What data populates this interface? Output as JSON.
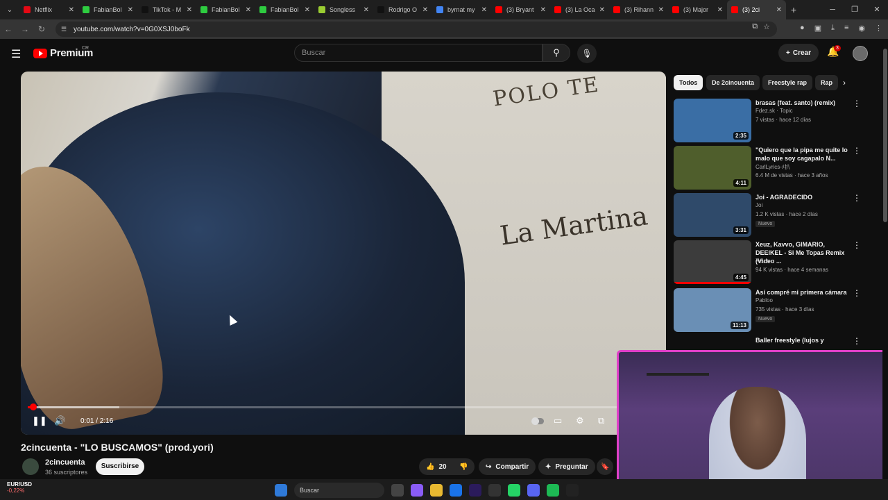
{
  "browser": {
    "tabs": [
      {
        "title": "Netflix",
        "color": "#e50914"
      },
      {
        "title": "FabianBol",
        "color": "#2ecc40"
      },
      {
        "title": "TikTok - M",
        "color": "#111111"
      },
      {
        "title": "FabianBol",
        "color": "#2ecc40"
      },
      {
        "title": "FabianBol",
        "color": "#2ecc40"
      },
      {
        "title": "Songless",
        "color": "#9acd32"
      },
      {
        "title": "Rodrigo O",
        "color": "#111111"
      },
      {
        "title": "byrnat my",
        "color": "#4285f4"
      },
      {
        "title": "(3) Bryant",
        "color": "#ff0000"
      },
      {
        "title": "(3) La Oca",
        "color": "#ff0000"
      },
      {
        "title": "(3) Rihann",
        "color": "#ff0000"
      },
      {
        "title": "(3) Major",
        "color": "#ff0000"
      },
      {
        "title": "(3) 2ci",
        "color": "#ff0000"
      }
    ],
    "url": "youtube.com/watch?v=0G0XSJ0boFk"
  },
  "header": {
    "logo_text": "Premium",
    "region": "CR",
    "search_placeholder": "Buscar",
    "create_label": "Crear",
    "notif_count": "3"
  },
  "player": {
    "time": "0:01 / 2:16",
    "shirt_text1": "POLO TE",
    "shirt_text2": "La Martina",
    "progress_played": 0.008,
    "progress_buffered": 0.145
  },
  "video": {
    "title": "2cincuenta - \"LO BUSCAMOS\" (prod.yori)",
    "channel": "2cincuenta",
    "subscribers": "36 suscriptores",
    "subscribe_label": "Suscribirse",
    "likes": "20",
    "share_label": "Compartir",
    "ask_label": "Preguntar"
  },
  "chips": [
    "Todos",
    "De 2cincuenta",
    "Freestyle rap",
    "Rap"
  ],
  "recommendations": [
    {
      "title": "brasas (feat. santo) (remix)",
      "channel": "Fdez.sk · Topic",
      "meta": "7 vistas · hace 12 días",
      "duration": "2:35",
      "badge": "",
      "thumb": "#3a6ea5"
    },
    {
      "title": "\"Quiero que la pipa me quite lo malo que soy cagapalo N...",
      "channel": "CarlLyrics-ﾒ扒",
      "meta": "6.4 M de vistas · hace 3 años",
      "duration": "4:11",
      "badge": "",
      "thumb": "#4f5e2c"
    },
    {
      "title": "Joi - AGRADECIDO",
      "channel": "Joi",
      "meta": "1.2 K vistas · hace 2 días",
      "duration": "3:31",
      "badge": "Nuevo",
      "thumb": "#2f4a6a"
    },
    {
      "title": "Xeuz, Kavvo, GIMARIO, DEEIKEL - Si Me Topas Remix (Video ...",
      "channel": "Xeuz",
      "meta": "94 K vistas · hace 4 semanas",
      "duration": "4:45",
      "badge": "",
      "thumb": "#3c3c3c"
    },
    {
      "title": "Así compré mi primera cámara",
      "channel": "Pabloo",
      "meta": "735 vistas · hace 3 días",
      "duration": "11:13",
      "badge": "Nuevo",
      "thumb": "#6a8fb5"
    },
    {
      "title": "Baller freestyle (lujos y",
      "channel": "",
      "meta": "",
      "duration": "",
      "badge": "",
      "thumb": "#222222"
    }
  ],
  "taskbar": {
    "fx_pair": "EUR/USD",
    "fx_change": "-0,22%",
    "search_label": "Buscar"
  }
}
